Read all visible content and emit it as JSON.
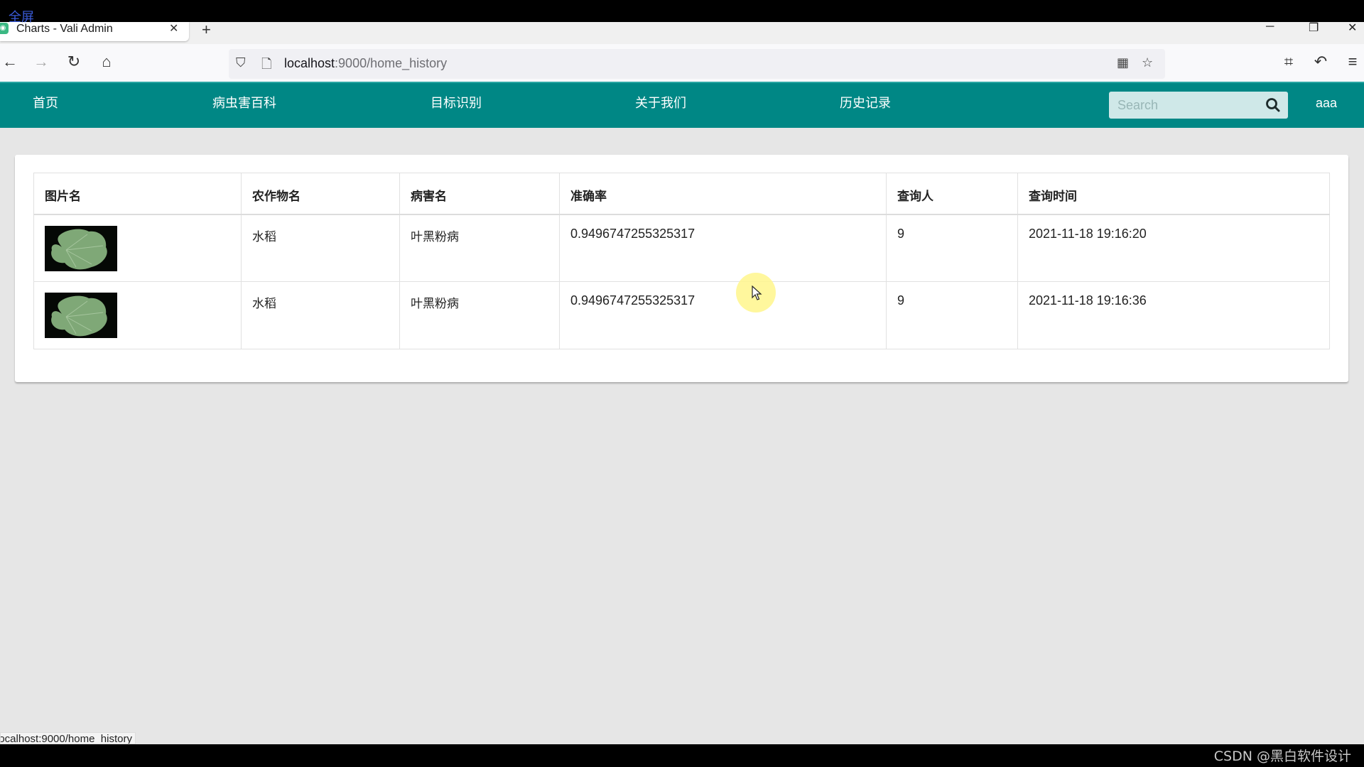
{
  "overlay": {
    "fullscreen_label": "全屏"
  },
  "browser": {
    "tab_title": "Charts - Vali Admin",
    "url_host": "localhost",
    "url_rest": ":9000/home_history",
    "status_url": "localhost:9000/home_history"
  },
  "nav": {
    "items": [
      {
        "label": "首页"
      },
      {
        "label": "病虫害百科"
      },
      {
        "label": "目标识别"
      },
      {
        "label": "关于我们"
      },
      {
        "label": "历史记录"
      }
    ],
    "search_placeholder": "Search",
    "user": "aaa",
    "color": "#008785"
  },
  "table": {
    "headers": [
      "图片名",
      "农作物名",
      "病害名",
      "准确率",
      "查询人",
      "查询时间"
    ],
    "rows": [
      {
        "image": "leaf-image",
        "crop": "水稻",
        "disease": "叶黑粉病",
        "accuracy": "0.9496747255325317",
        "user": "9",
        "time": "2021-11-18 19:16:20"
      },
      {
        "image": "leaf-image",
        "crop": "水稻",
        "disease": "叶黑粉病",
        "accuracy": "0.9496747255325317",
        "user": "9",
        "time": "2021-11-18 19:16:36"
      }
    ]
  },
  "watermark": "CSDN @黑白软件设计"
}
